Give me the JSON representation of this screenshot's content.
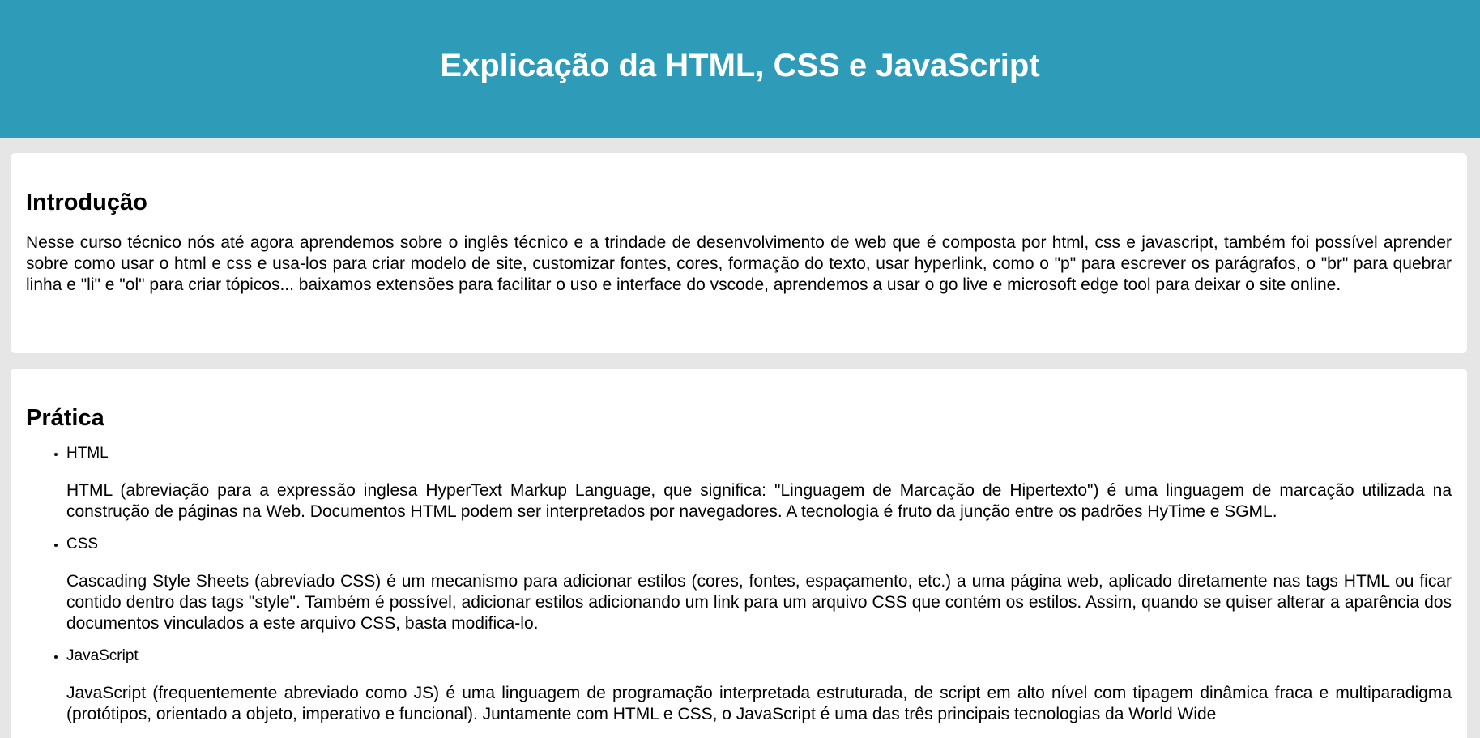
{
  "header": {
    "title": "Explicação da HTML, CSS e JavaScript"
  },
  "intro": {
    "heading": "Introdução",
    "text": "Nesse curso técnico nós até agora aprendemos sobre o inglês técnico e a trindade de desenvolvimento de web que é composta por html, css e javascript, também foi possível aprender sobre como usar o html e css e usa-los para criar modelo de site, customizar fontes, cores, formação do texto, usar hyperlink, como o \"p\" para escrever os parágrafos, o \"br\" para quebrar linha e \"li\" e \"ol\" para criar tópicos... baixamos extensões para facilitar o uso e interface do vscode, aprendemos a usar o go live e microsoft edge tool para deixar o site online."
  },
  "pratica": {
    "heading": "Prática",
    "items": [
      {
        "title": "HTML",
        "text": "HTML (abreviação para a expressão inglesa HyperText Markup Language, que significa: \"Linguagem de Marcação de Hipertexto\") é uma linguagem de marcação utilizada na construção de páginas na Web. Documentos HTML podem ser interpretados por navegadores. A tecnologia é fruto da junção entre os padrões HyTime e SGML."
      },
      {
        "title": "CSS",
        "text": "Cascading Style Sheets (abreviado CSS) é um mecanismo para adicionar estilos (cores, fontes, espaçamento, etc.) a uma página web, aplicado diretamente nas tags HTML ou ficar contido dentro das tags \"style\". Também é possível, adicionar estilos adicionando um link para um arquivo CSS que contém os estilos. Assim, quando se quiser alterar a aparência dos documentos vinculados a este arquivo CSS, basta modifica-lo."
      },
      {
        "title": "JavaScript",
        "text": "JavaScript (frequentemente abreviado como JS) é uma linguagem de programação interpretada estruturada, de script em alto nível com tipagem dinâmica fraca e multiparadigma (protótipos, orientado a objeto, imperativo e funcional). Juntamente com HTML e CSS, o JavaScript é uma das três principais tecnologias da World Wide"
      }
    ]
  },
  "colors": {
    "header_bg": "#2e9bb8",
    "page_bg": "#e6e6e6",
    "card_bg": "#ffffff"
  }
}
